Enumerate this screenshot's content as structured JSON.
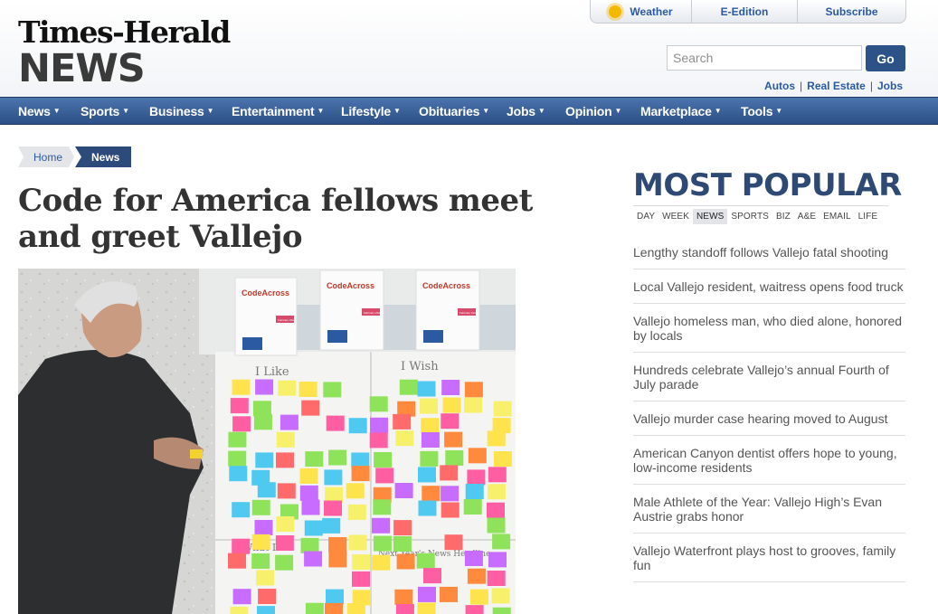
{
  "brand": {
    "line1": "Times-Herald",
    "line2": "NEWS"
  },
  "top_links": {
    "weather": "Weather",
    "eedition": "E-Edition",
    "subscribe": "Subscribe"
  },
  "search": {
    "placeholder": "Search",
    "button": "Go"
  },
  "quick_links": [
    "Autos",
    "Real Estate",
    "Jobs"
  ],
  "nav": [
    "News",
    "Sports",
    "Business",
    "Entertainment",
    "Lifestyle",
    "Obituaries",
    "Jobs",
    "Opinion",
    "Marketplace",
    "Tools"
  ],
  "breadcrumb": {
    "home": "Home",
    "current": "News"
  },
  "article": {
    "headline": "Code for America fellows meet and greet Vallejo"
  },
  "photo_signs": [
    {
      "title": "CodeAcross",
      "date": "February 21st"
    },
    {
      "title": "CodeAcross",
      "date": "February 21st"
    },
    {
      "title": "CodeAcross",
      "date": "February 21st"
    }
  ],
  "board_labels": {
    "left": "I Like",
    "right": "I Wish",
    "bottom_left": "What I",
    "bottom_right": "Next Year's News Headline"
  },
  "most_popular": {
    "title": "MOST POPULAR",
    "tabs": [
      "DAY",
      "WEEK",
      "NEWS",
      "SPORTS",
      "BIZ",
      "A&E",
      "EMAIL",
      "LIFE"
    ],
    "active_tab": "NEWS",
    "items": [
      "Lengthy standoff follows Vallejo fatal shooting",
      "Local Vallejo resident, waitress opens food truck",
      "Vallejo homeless man, who died alone, honored by locals",
      "Hundreds celebrate Vallejo’s annual Fourth of July parade",
      "Vallejo murder case hearing moved to August",
      "American Canyon dentist offers hope to young, low-income residents",
      "Male Athlete of the Year: Vallejo High’s Evan Austrie grabs honor",
      "Vallejo Waterfront plays host to grooves, family fun"
    ]
  },
  "colors": {
    "brand_blue": "#2c5288",
    "nav_blue": "#3a619b",
    "link_blue": "#2b5aa3",
    "popular_title": "#2e4a74"
  }
}
